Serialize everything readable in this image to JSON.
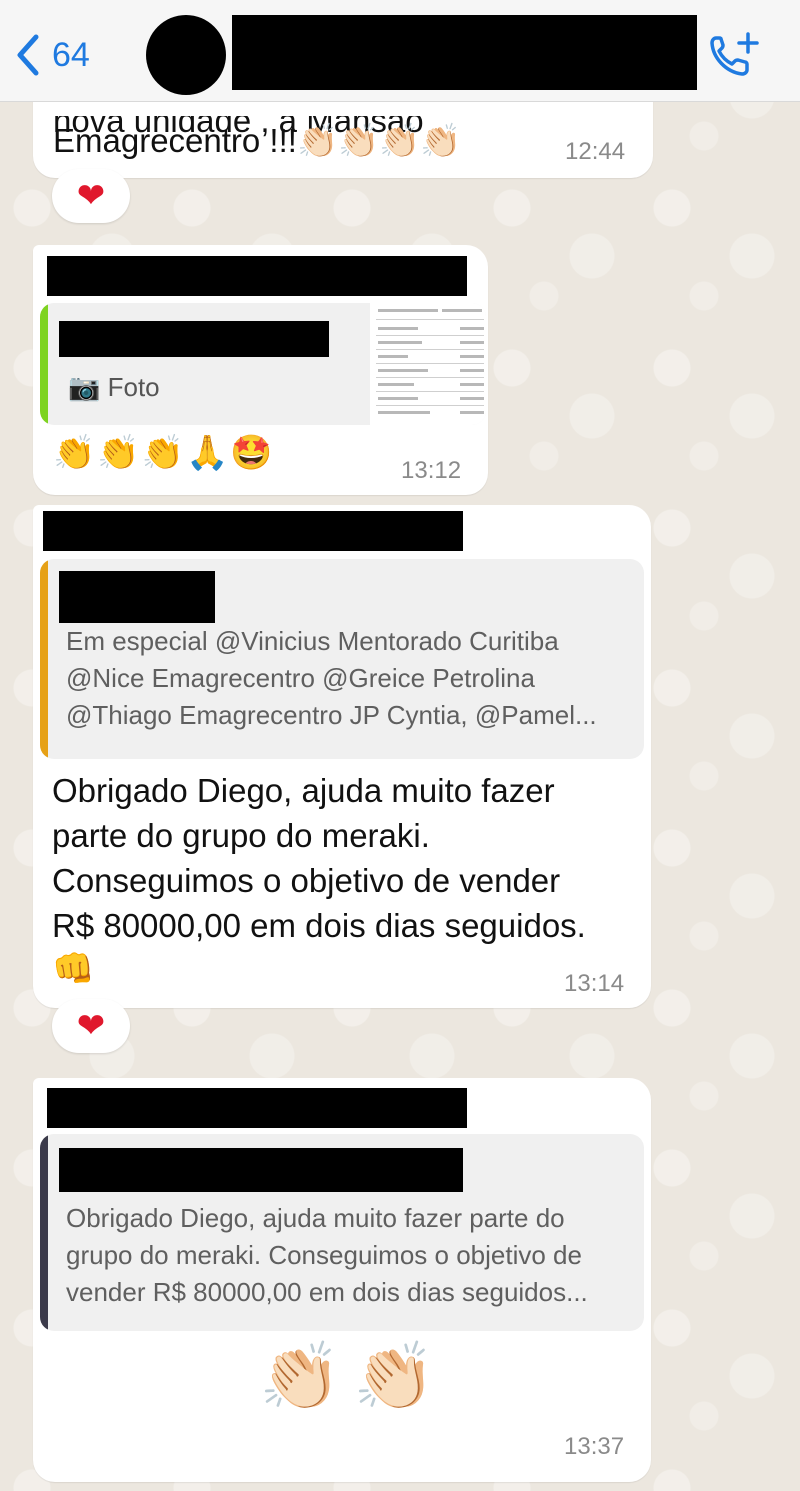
{
  "header": {
    "back_count": "64"
  },
  "messages": [
    {
      "text": "Emagrecentro !!!👏🏻👏🏻👏🏻👏🏻",
      "partial_text": "nova unidade , a Mansão",
      "time": "12:44",
      "reaction": "❤"
    },
    {
      "quote_label": "📷 Foto",
      "emojis": "👏👏👏🙏🤩",
      "time": "13:12"
    },
    {
      "quote_lines": [
        "Em especial @Vinicius Mentorado Curitiba",
        "@Nice Emagrecentro @Greice Petrolina",
        "@Thiago Emagrecentro JP Cyntia, @Pamel..."
      ],
      "text_lines": [
        "Obrigado Diego, ajuda muito fazer",
        "parte do grupo do meraki.",
        "Conseguimos o objetivo de vender",
        "R$ 80000,00 em dois dias seguidos."
      ],
      "trailing_emoji": "👊",
      "time": "13:14",
      "reaction": "❤"
    },
    {
      "quote_lines": [
        "Obrigado Diego, ajuda muito fazer parte do",
        "grupo do meraki. Conseguimos o objetivo de",
        "vender R$ 80000,00 em dois dias seguidos..."
      ],
      "big_emojis": "👏🏻👏🏻",
      "time": "13:37"
    }
  ],
  "colors": {
    "ios_blue": "#1f7ae0",
    "quote_green": "#7ed321",
    "quote_orange": "#e6a117",
    "quote_dark": "#3b3a4a",
    "reaction_red": "#e0182d"
  }
}
